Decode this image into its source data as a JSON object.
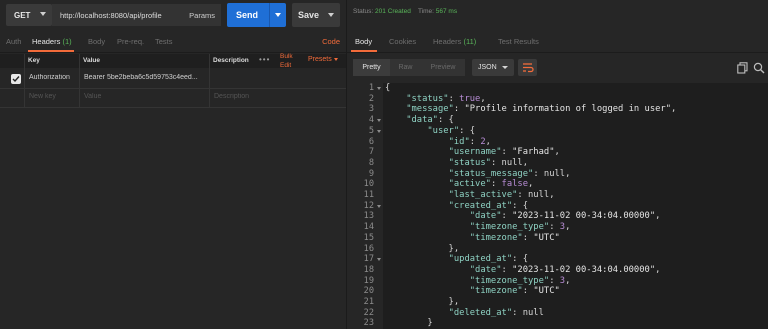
{
  "request": {
    "method": "GET",
    "url": "http://localhost:8080/api/profile",
    "params_label": "Params",
    "send_label": "Send",
    "save_label": "Save"
  },
  "request_tabs": {
    "auth": "Auth",
    "headers": "Headers",
    "headers_count": "(1)",
    "body": "Body",
    "prereq": "Pre-req.",
    "tests": "Tests",
    "code": "Code"
  },
  "headers_table": {
    "col_key": "Key",
    "col_value": "Value",
    "col_description": "Description",
    "more": "•••",
    "bulk_edit_line1": "Bulk",
    "bulk_edit_line2": "Edit",
    "presets": "Presets",
    "rows": [
      {
        "key": "Authorization",
        "value": "Bearer 5be2beba6c5d59753c4eed...",
        "description": "",
        "checked": true
      }
    ],
    "new_row": {
      "key": "New key",
      "value": "Value",
      "description": "Description"
    }
  },
  "response": {
    "status_label": "Status:",
    "status_value": "201 Created",
    "time_label": "Time:",
    "time_value": "567 ms"
  },
  "response_tabs": {
    "body": "Body",
    "cookies": "Cookies",
    "headers": "Headers",
    "headers_count": "(11)",
    "test_results": "Test Results"
  },
  "view": {
    "pretty": "Pretty",
    "raw": "Raw",
    "preview": "Preview",
    "format": "JSON"
  },
  "code_lines": [
    "{",
    "    \"status\": true,",
    "    \"message\": \"Profile information of logged in user\",",
    "    \"data\": {",
    "        \"user\": {",
    "            \"id\": 2,",
    "            \"username\": \"Farhad\",",
    "            \"status\": null,",
    "            \"status_message\": null,",
    "            \"active\": false,",
    "            \"last_active\": null,",
    "            \"created_at\": {",
    "                \"date\": \"2023-11-02 00-34:04.00000\",",
    "                \"timezone_type\": 3,",
    "                \"timezone\": \"UTC\"",
    "            },",
    "            \"updated_at\": {",
    "                \"date\": \"2023-11-02 00-34:04.00000\",",
    "                \"timezone_type\": 3,",
    "                \"timezone\": \"UTC\"",
    "            },",
    "            \"deleted_at\": null",
    "        }"
  ],
  "line_numbers": [
    "1",
    "2",
    "3",
    "4",
    "5",
    "6",
    "7",
    "8",
    "9",
    "10",
    "11",
    "12",
    "13",
    "14",
    "15",
    "16",
    "17",
    "18",
    "19",
    "20",
    "21",
    "22",
    "23"
  ],
  "colors": {
    "accent": "#f26b3a",
    "send": "#1f6fd6",
    "status_ok": "#5ab65a",
    "json_key": "#8fd3c4",
    "json_literal": "#b88dd6"
  },
  "icons": [
    "chevron-down-icon",
    "checkbox-checked-icon",
    "wrap-lines-icon",
    "copy-icon",
    "search-icon"
  ]
}
